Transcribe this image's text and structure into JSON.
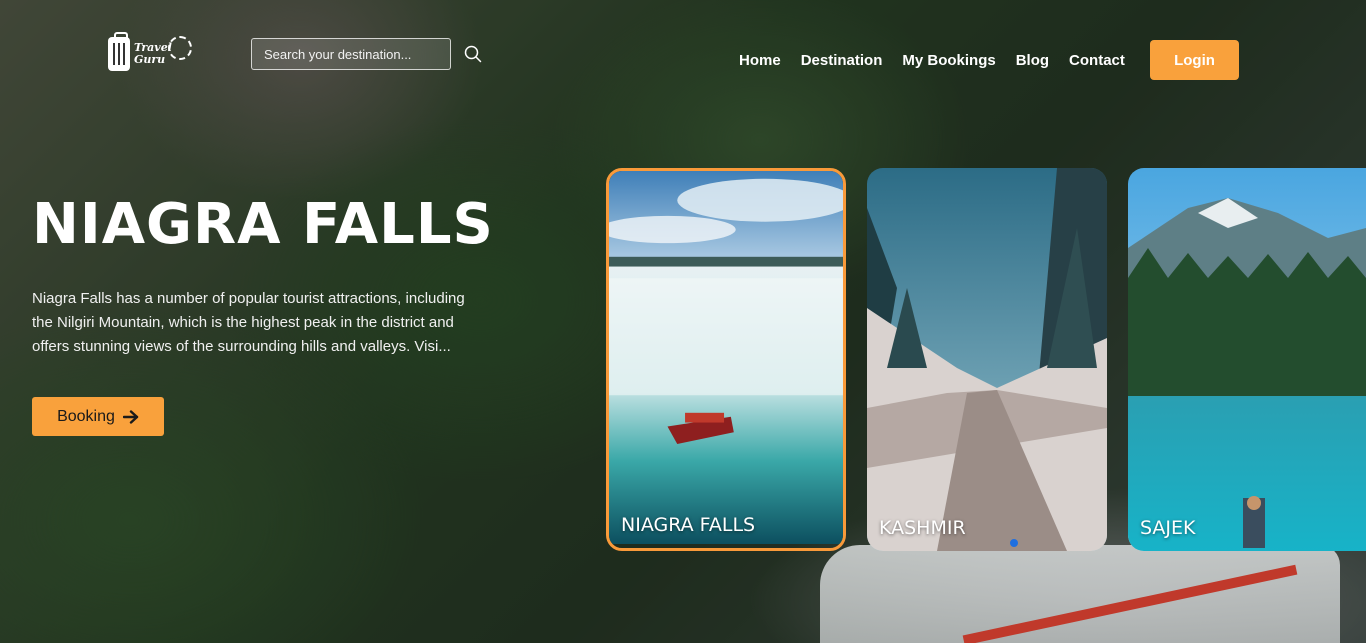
{
  "brand": {
    "line1": "Travel",
    "line2": "Guru"
  },
  "search": {
    "placeholder": "Search your destination..."
  },
  "nav": {
    "items": [
      "Home",
      "Destination",
      "My Bookings",
      "Blog",
      "Contact"
    ],
    "login_label": "Login"
  },
  "hero": {
    "title": "NIAGRA FALLS",
    "description": "Niagra Falls has a number of popular tourist attractions, including the Nilgiri Mountain, which is the highest peak in the district and offers stunning views of the surrounding hills and valleys. Visi...",
    "button_label": "Booking"
  },
  "cards": [
    {
      "label": "NIAGRA FALLS",
      "active": true
    },
    {
      "label": "KASHMIR",
      "active": false
    },
    {
      "label": "SAJEK",
      "active": false
    }
  ],
  "colors": {
    "accent": "#f9a13c",
    "active_border": "#f99a3a",
    "indicator": "#1e6fe0"
  },
  "icons": {
    "search": "search-icon",
    "booking_arrow": "arrow-right-icon",
    "logo": "suitcase-icon"
  }
}
